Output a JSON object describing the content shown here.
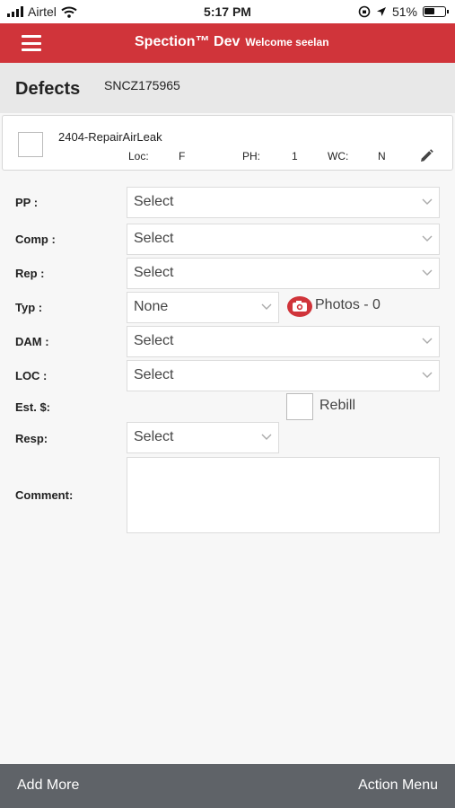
{
  "status_bar": {
    "carrier": "Airtel",
    "time": "5:17 PM",
    "battery_percent": "51%",
    "battery_level": 0.51,
    "icons": [
      "signal-bars-icon",
      "wifi-icon",
      "screen-lock-icon",
      "location-arrow-icon",
      "battery-icon"
    ]
  },
  "app_bar": {
    "title": "Spection™ Dev",
    "welcome": "Welcome seelan",
    "menu_icon": "hamburger-icon",
    "color": "#d0343a"
  },
  "sub_header": {
    "title": "Defects",
    "id": "SNCZ175965"
  },
  "defect_card": {
    "code": "2404-RepairAirLeak",
    "loc_label": "Loc:",
    "loc_value": "F",
    "ph_label": "PH:",
    "ph_value": "1",
    "wc_label": "WC:",
    "wc_value": "N",
    "edit_icon": "pencil-icon"
  },
  "form": {
    "pp": {
      "label": "PP :",
      "value": "Select"
    },
    "comp": {
      "label": "Comp :",
      "value": "Select"
    },
    "rep": {
      "label": "Rep :",
      "value": "Select"
    },
    "typ": {
      "label": "Typ :",
      "value": "None"
    },
    "photos": {
      "label": "Photos -  0",
      "icon": "camera-icon"
    },
    "dam": {
      "label": "DAM :",
      "value": "Select"
    },
    "loc": {
      "label": "LOC :",
      "value": "Select"
    },
    "est": {
      "label": "Est. $:"
    },
    "rebill": {
      "label": "Rebill",
      "checked": false
    },
    "resp": {
      "label": "Resp:",
      "value": "Select"
    },
    "comment": {
      "label": "Comment:",
      "value": ""
    }
  },
  "footer": {
    "add_more": "Add More",
    "action_menu": "Action Menu",
    "color": "#5f6368"
  }
}
